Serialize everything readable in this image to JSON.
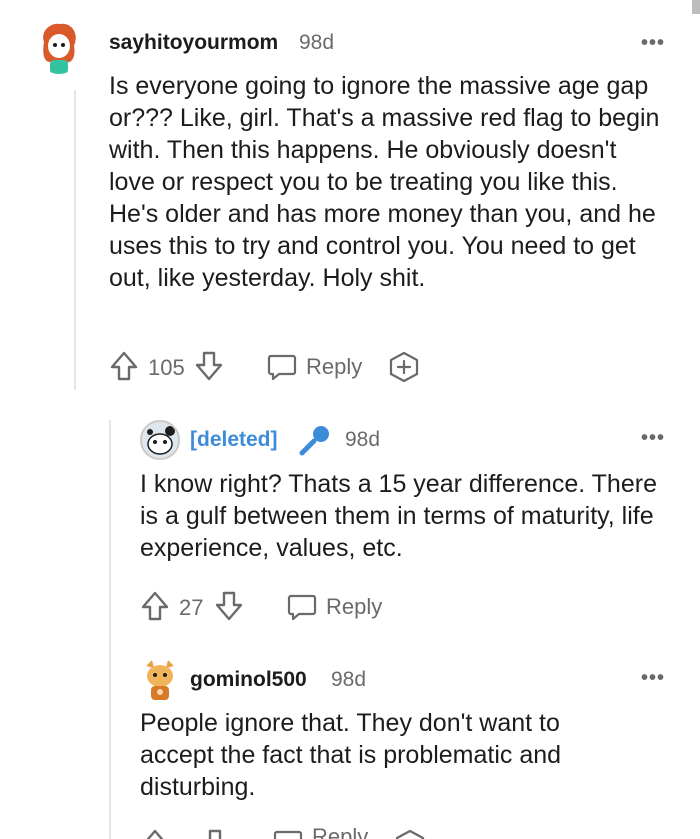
{
  "comments": [
    {
      "username": "sayhitoyourmom",
      "age": "98d",
      "body": "Is everyone going to ignore the massive age gap or??? Like, girl. That's a massive red flag to begin with. Then this happens. He obviously doesn't love or respect you to be treating you like this. He's older and has more money than you, and he uses this to try and control you. You need to get out, like yesterday. Holy shit.",
      "votes": "105",
      "reply_label": "Reply"
    },
    {
      "username": "[deleted]",
      "age": "98d",
      "body": "I know right? Thats a 15 year difference. There is a gulf between them in terms of maturity, life experience, values, etc.",
      "votes": "27",
      "reply_label": "Reply"
    },
    {
      "username": "gominol500",
      "age": "98d",
      "body": "People ignore that. They don't want to accept the fact that is problematic and disturbing.",
      "reply_label": "Reply"
    }
  ],
  "more_glyph": "•••",
  "icons": [
    "avatar",
    "upvote-icon",
    "downvote-icon",
    "reply-icon",
    "award-icon",
    "microphone-icon"
  ],
  "colors": {
    "deleted_user": "#3d8cd9",
    "meta_gray": "#6a6a6a",
    "text": "#1c1c1c"
  }
}
